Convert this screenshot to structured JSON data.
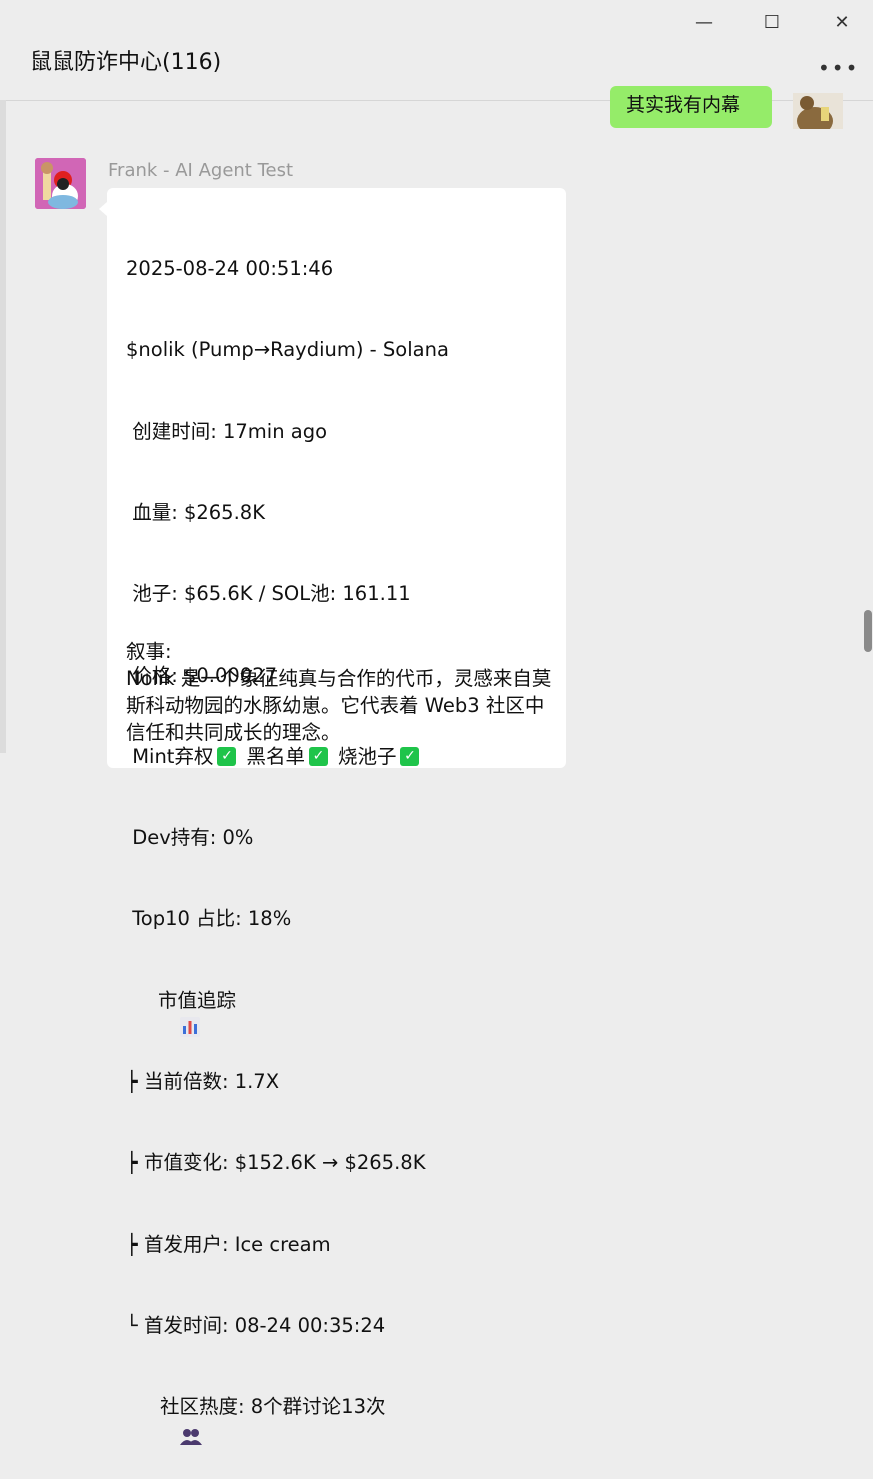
{
  "window": {
    "minimize_icon": "minimize-icon",
    "maximize_icon": "maximize-icon",
    "close_icon": "close-icon",
    "min_glyph": "—",
    "max_glyph": "☐",
    "close_glyph": "✕"
  },
  "header": {
    "title": "鼠鼠防诈中心(116)",
    "more_label": "•••"
  },
  "my_message": {
    "text": "其实我有内幕"
  },
  "message": {
    "sender": "Frank - AI Agent Test",
    "lines": {
      "l1": "2025-08-24 00:51:46",
      "l2": "$nolik (Pump→Raydium) - Solana",
      "l3": " 创建时间: 17min ago",
      "l4": " 血量: $265.8K",
      "l5": " 池子: $65.6K / SOL池: 161.11",
      "l6": " 价格: $0.00027",
      "mint_label": " Mint弃权",
      "blacklist_label": "黑名单",
      "burn_label": "烧池子",
      "check_glyph": "✓",
      "l8": " Dev持有: 0%",
      "l9": " Top10 占比: 18%",
      "tracking_label": "市值追踪",
      "l11": "┝ 当前倍数: 1.7X",
      "l12": "┝ 市值变化: $152.6K → $265.8K",
      "l13": "┝ 首发用户: Ice cream",
      "l14": "└ 首发时间: 08-24 00:35:24",
      "community_label": "社区热度: 8个群讨论13次"
    },
    "narrative": {
      "heading": "叙事:",
      "body": "Nolik 是一个象征纯真与合作的代币，灵感来自莫斯科动物园的水豚幼崽。它代表着 Web3 社区中信任和共同成长的理念。"
    }
  }
}
